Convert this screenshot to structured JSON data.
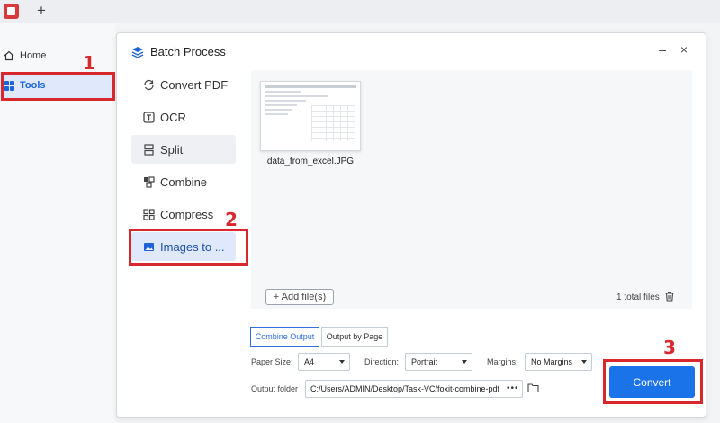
{
  "topbar": {
    "new_tab_glyph": "+"
  },
  "sidebar": {
    "items": [
      {
        "label": "Home",
        "icon": "home-icon"
      },
      {
        "label": "Tools",
        "icon": "tools-icon"
      }
    ]
  },
  "annotations": [
    "1",
    "2",
    "3"
  ],
  "dialog": {
    "title": "Batch Process",
    "minimize_glyph": "–",
    "close_glyph": "×",
    "nav": [
      {
        "label": "Convert PDF",
        "icon": "convert-icon"
      },
      {
        "label": "OCR",
        "icon": "ocr-icon"
      },
      {
        "label": "Split",
        "icon": "split-icon"
      },
      {
        "label": "Combine",
        "icon": "combine-icon"
      },
      {
        "label": "Compress",
        "icon": "compress-icon"
      },
      {
        "label": "Images to ...",
        "icon": "image-icon"
      }
    ],
    "files": [
      {
        "name": "data_from_excel.JPG"
      }
    ],
    "add_files_label": "+ Add file(s)",
    "total_files": "1 total files",
    "output_tabs": {
      "combine": "Combine Output",
      "by_page": "Output by Page"
    },
    "paper_size": {
      "label": "Paper Size:",
      "value": "A4"
    },
    "direction": {
      "label": "Direction:",
      "value": "Portrait"
    },
    "margins": {
      "label": "Margins:",
      "value": "No Margins"
    },
    "output_folder": {
      "label": "Output folder",
      "value": "C:/Users/ADMIN/Desktop/Task-VC/foxit-combine-pdf",
      "more": "•••"
    },
    "convert_label": "Convert"
  },
  "colors": {
    "accent": "#1a73e8",
    "annotation": "#d9272e",
    "app_logo": "#d63b3b"
  }
}
